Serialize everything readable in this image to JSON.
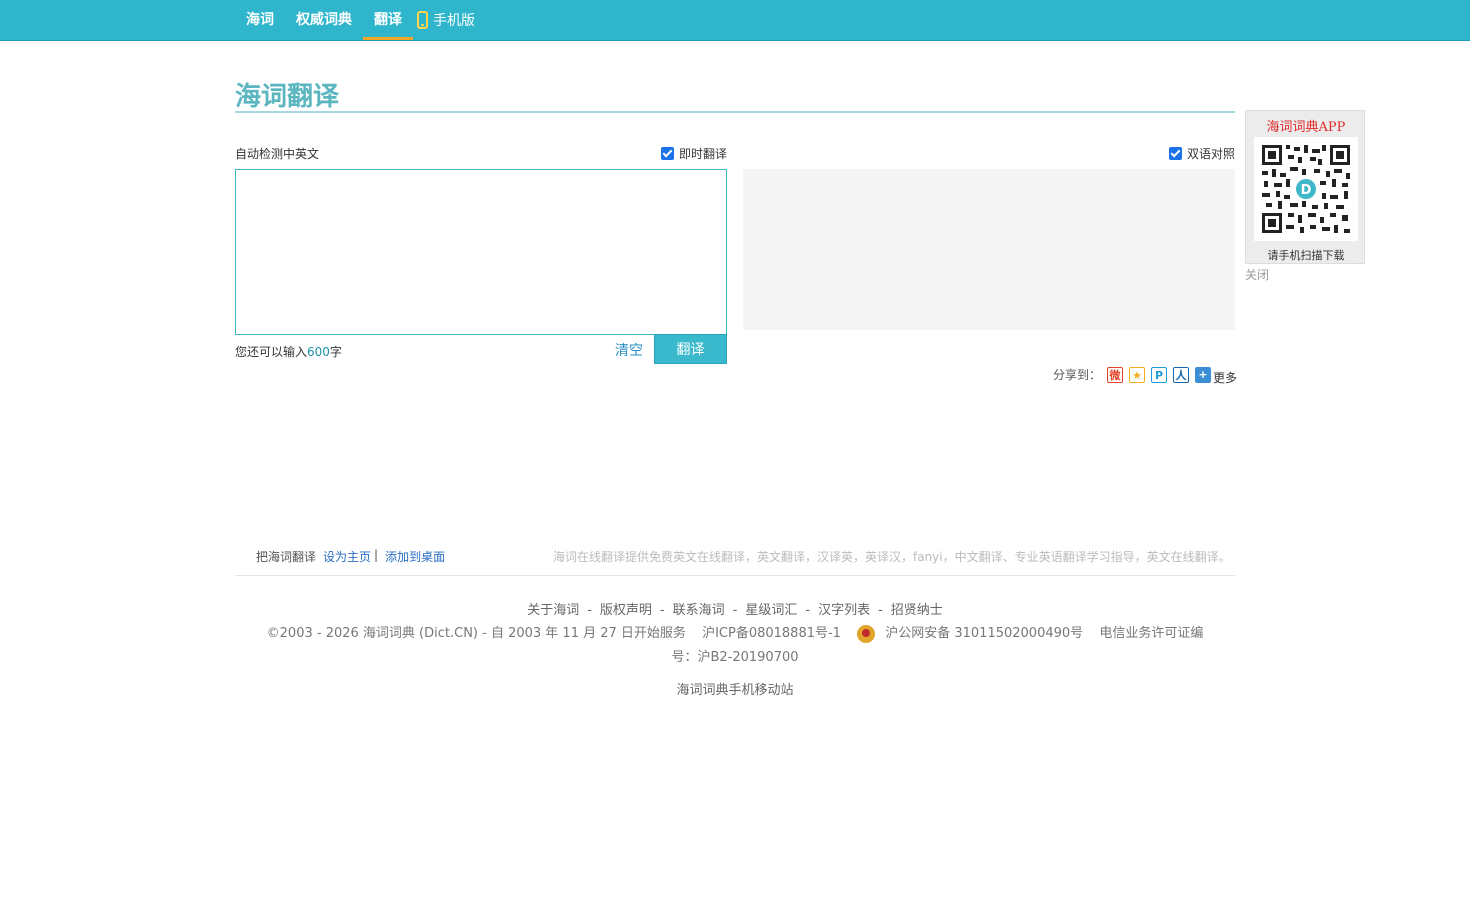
{
  "nav": {
    "items": [
      "海词",
      "权威词典",
      "翻译"
    ],
    "mobile_label": "手机版"
  },
  "logo_text": "海词翻译",
  "input_panel": {
    "detect_label": "自动检测中英文",
    "instant_label": "即时翻译",
    "input_value": "",
    "remain_prefix": "您还可以输入",
    "remain_count": "600",
    "remain_suffix": "字",
    "clear_label": "清空",
    "translate_label": "翻译"
  },
  "output_panel": {
    "bilingual_label": "双语对照",
    "result_text": ""
  },
  "share": {
    "label": "分享到：",
    "icons": [
      "weibo-icon",
      "qzone-icon",
      "tencent-weibo-icon",
      "renren-icon",
      "more-share-icon"
    ],
    "more_label": "更多"
  },
  "qr": {
    "title": "海词词典APP",
    "caption": "请手机扫描下载",
    "close_label": "关闭"
  },
  "bookmark": {
    "prefix": "把海词翻译",
    "set_home": "设为主页",
    "sep": "|",
    "add_desktop": "添加到桌面"
  },
  "description": "海词在线翻译提供免费英文在线翻译，英文翻译，汉译英，英译汉，fanyi，中文翻译、专业英语翻译学习指导，英文在线翻译。",
  "footer": {
    "links": [
      "关于海词",
      "版权声明",
      "联系海词",
      "星级词汇",
      "汉字列表",
      "招贤纳士"
    ],
    "link_sep": "-",
    "copyright": "©2003 - 2026  海词词典 (Dict.CN) - 自 2003 年 11 月 27 日开始服务",
    "icp": "沪ICP备08018881号-1",
    "police": "沪公网安备 31011502000490号",
    "license": "电信业务许可证编号：沪B2-20190700",
    "mobile_site": "海词词典手机移动站"
  }
}
